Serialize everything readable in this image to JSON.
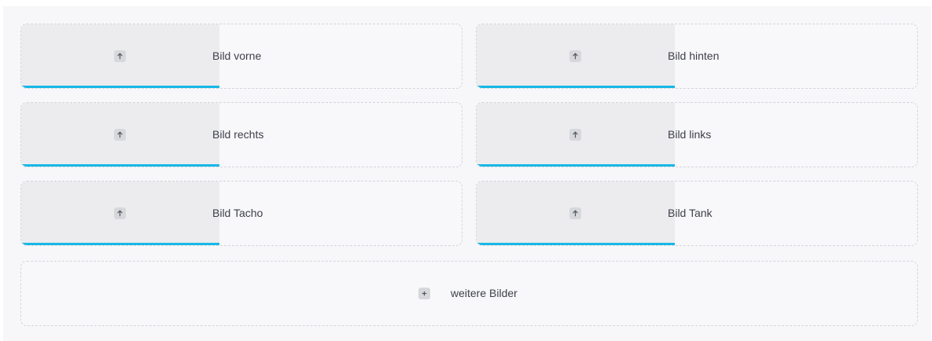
{
  "upload_slots": [
    {
      "label": "Bild vorne",
      "progress_percent": 45
    },
    {
      "label": "Bild hinten",
      "progress_percent": 45
    },
    {
      "label": "Bild rechts",
      "progress_percent": 45
    },
    {
      "label": "Bild links",
      "progress_percent": 45
    },
    {
      "label": "Bild Tacho",
      "progress_percent": 45
    },
    {
      "label": "Bild Tank",
      "progress_percent": 45
    }
  ],
  "more_images": {
    "label": "weitere Bilder"
  },
  "colors": {
    "progress_line": "#17b8e6",
    "progress_fill": "#ececee",
    "border": "#d4d6dc",
    "text": "#3d3f4a"
  },
  "icons": {
    "slot_icon": "upload-arrow-icon",
    "more_icon": "plus-icon"
  }
}
